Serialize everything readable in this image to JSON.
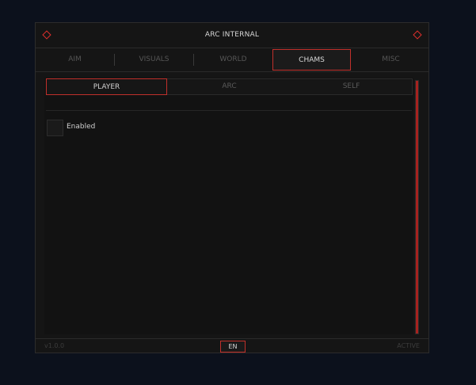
{
  "window": {
    "title": "ARC INTERNAL"
  },
  "tabs": [
    {
      "label": "AIM"
    },
    {
      "label": "VISUALS"
    },
    {
      "label": "WORLD"
    },
    {
      "label": "CHAMS",
      "active": true
    },
    {
      "label": "MISC"
    }
  ],
  "subtabs": [
    {
      "label": "PLAYER",
      "active": true
    },
    {
      "label": "ARC"
    },
    {
      "label": "SELF"
    }
  ],
  "options": {
    "enabled_label": "Enabled",
    "enabled_checked": false
  },
  "footer": {
    "version": "v1.0.0",
    "language": "EN",
    "status": "ACTIVE"
  },
  "colors": {
    "accent": "#c0302b",
    "background": "#0c111c",
    "panel": "#151515"
  },
  "icons": {
    "corner_left": "diamond-icon",
    "corner_right": "diamond-icon"
  }
}
